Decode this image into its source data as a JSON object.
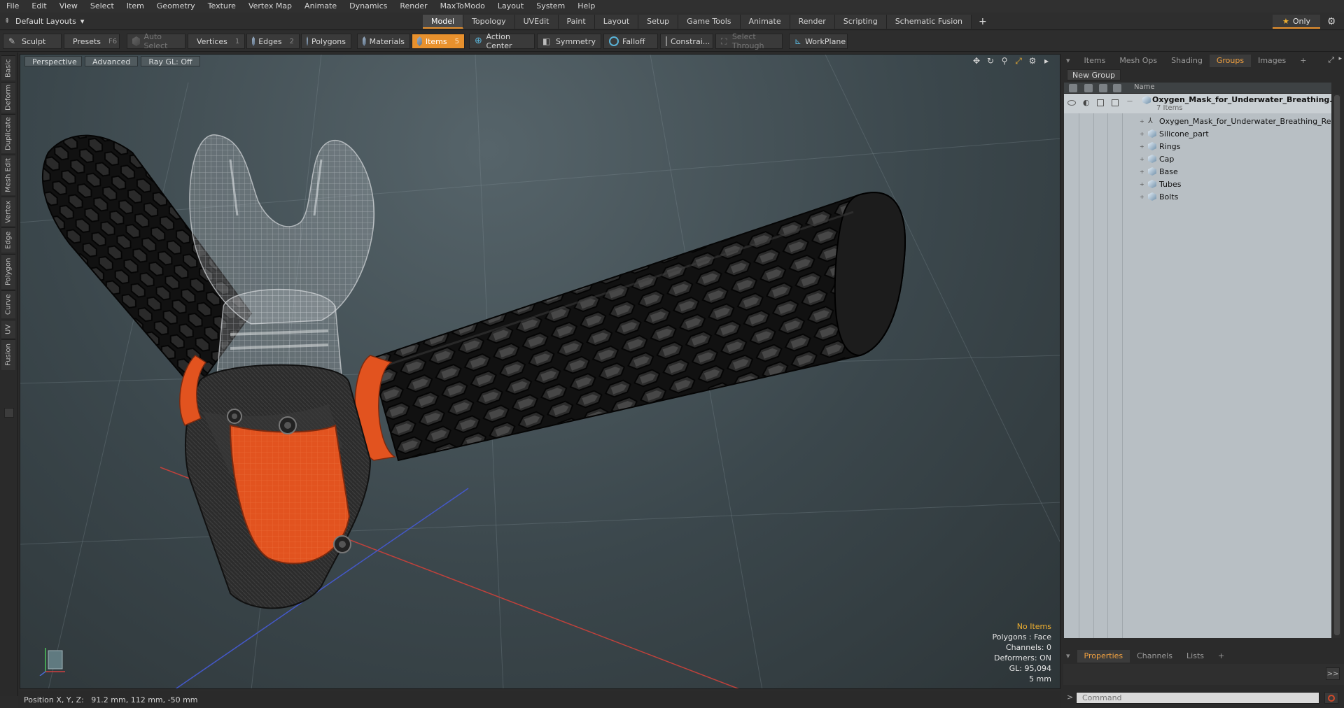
{
  "menu": [
    "File",
    "Edit",
    "View",
    "Select",
    "Item",
    "Geometry",
    "Texture",
    "Vertex Map",
    "Animate",
    "Dynamics",
    "Render",
    "MaxToModo",
    "Layout",
    "System",
    "Help"
  ],
  "layout_dropdown": "Default Layouts",
  "tabs": [
    "Model",
    "Topology",
    "UVEdit",
    "Paint",
    "Layout",
    "Setup",
    "Game Tools",
    "Animate",
    "Render",
    "Scripting",
    "Schematic Fusion"
  ],
  "active_tab": "Model",
  "only_label": "Only",
  "toolbar": {
    "sculpt": "Sculpt",
    "presets": "Presets",
    "presets_key": "F6",
    "auto_select": "Auto Select",
    "vertices": "Vertices",
    "vertices_key": "1",
    "edges": "Edges",
    "edges_key": "2",
    "polygons": "Polygons",
    "materials": "Materials",
    "items": "Items",
    "items_key": "5",
    "action_center": "Action Center",
    "symmetry": "Symmetry",
    "falloff": "Falloff",
    "constraints": "Constrai...",
    "select_through": "Select Through",
    "workplane": "WorkPlane"
  },
  "left_tabs": [
    "Basic",
    "Deform",
    "Duplicate",
    "Mesh Edit",
    "Vertex",
    "Edge",
    "Polygon",
    "Curve",
    "UV",
    "Fusion"
  ],
  "viewport": {
    "view": "Perspective",
    "shading": "Advanced",
    "raygl": "Ray GL: Off",
    "stats": {
      "selection": "No Items",
      "polygons": "Polygons : Face",
      "channels": "Channels: 0",
      "deformers": "Deformers: ON",
      "gl": "GL: 95,094",
      "unit": "5 mm"
    }
  },
  "status": "Position X, Y, Z:   91.2 mm, 112 mm, -50 mm",
  "right_panel": {
    "tabs": [
      "Items",
      "Mesh Ops",
      "Shading",
      "Groups",
      "Images"
    ],
    "active_tab": "Groups",
    "new_group": "New Group",
    "name_header": "Name",
    "root": {
      "name": "Oxygen_Mask_for_Underwater_Breathing...",
      "count": "7 Items"
    },
    "children": [
      {
        "name": "Oxygen_Mask_for_Underwater_Breathing_Red",
        "icon": "locator-icon"
      },
      {
        "name": "Silicone_part",
        "icon": "mesh-icon"
      },
      {
        "name": "Rings",
        "icon": "mesh-icon"
      },
      {
        "name": "Cap",
        "icon": "mesh-icon"
      },
      {
        "name": "Base",
        "icon": "mesh-icon"
      },
      {
        "name": "Tubes",
        "icon": "mesh-icon"
      },
      {
        "name": "Bolts",
        "icon": "mesh-icon"
      }
    ],
    "bottom_tabs": [
      "Properties",
      "Channels",
      "Lists"
    ],
    "bottom_active": "Properties",
    "command_placeholder": "Command"
  },
  "colors": {
    "accent": "#e8912d",
    "orange_part": "#e0501f"
  }
}
